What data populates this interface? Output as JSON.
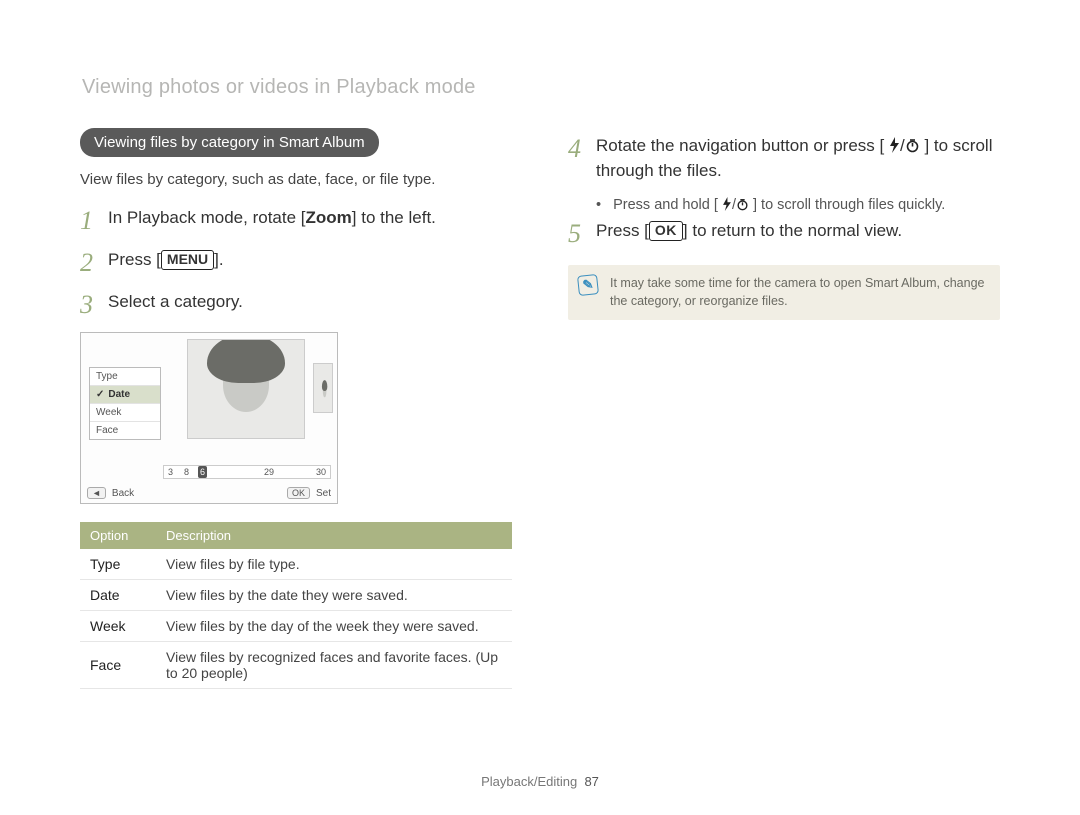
{
  "page_title": "Viewing photos or videos in Playback mode",
  "pill": "Viewing files by category in Smart Album",
  "lead": "View files by category, such as date, face, or file type.",
  "steps_left": {
    "1": {
      "pre": "In Playback mode, rotate [",
      "strong": "Zoom",
      "post": "] to the left."
    },
    "2": {
      "pre": "Press [",
      "kbd": "MENU",
      "post": "]."
    },
    "3": {
      "text": "Select a category."
    }
  },
  "shot": {
    "menu": [
      "Type",
      "Date",
      "Week",
      "Face"
    ],
    "selected": "Date",
    "timeline_labels": [
      "3",
      "8",
      "6",
      "29",
      "30"
    ],
    "back_label": "Back",
    "set_label": "Set",
    "ok_label": "OK"
  },
  "table": {
    "headers": {
      "option": "Option",
      "description": "Description"
    },
    "rows": [
      {
        "option": "Type",
        "desc": "View files by file type."
      },
      {
        "option": "Date",
        "desc": "View files by the date they were saved."
      },
      {
        "option": "Week",
        "desc": "View files by the day of the week they were saved."
      },
      {
        "option": "Face",
        "desc": "View files by recognized faces and favorite faces. (Up to 20 people)"
      }
    ]
  },
  "steps_right": {
    "4": {
      "pre": "Rotate the navigation button or press [",
      "icons": "flash-timer",
      "post": "] to scroll through the files."
    },
    "4_sub": {
      "pre": "Press and hold [",
      "post": "] to scroll through files quickly."
    },
    "5": {
      "pre": "Press [",
      "kbd": "OK",
      "post": "] to return to the normal view."
    }
  },
  "note_text": "It may take some time for the camera to open Smart Album, change the category, or reorganize files.",
  "footer": {
    "section": "Playback/Editing",
    "page": "87"
  }
}
